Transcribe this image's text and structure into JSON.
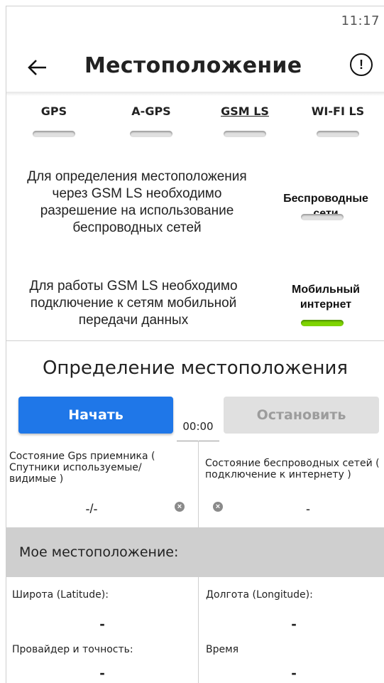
{
  "status_bar": {
    "time": "11:17"
  },
  "app_bar": {
    "title": "Местоположение",
    "back_icon": "arrow-left-icon",
    "info_icon": "exclamation-circle-icon"
  },
  "tabs": [
    {
      "label": "GPS",
      "enabled": false
    },
    {
      "label": "A-GPS",
      "enabled": false
    },
    {
      "label": "GSM LS",
      "enabled": false,
      "underlined": true
    },
    {
      "label": "WI-FI LS",
      "enabled": false
    }
  ],
  "wireless": {
    "description": "Для определения местоположения через GSM LS необходимо разрешение на использование беспроводных сетей",
    "toggle_label": "Беспроводные сети",
    "enabled": false
  },
  "mobile": {
    "description": "Для работы GSM LS необходимо подключение к сетям мобильной передачи данных",
    "toggle_label": "Мобильный интернет",
    "enabled": true,
    "on_color": "#7fd400"
  },
  "detection": {
    "title": "Определение местоположения",
    "start_label": "Начать",
    "stop_label": "Остановить",
    "timer": "00:00",
    "start_color": "#1f77e8"
  },
  "gps_state": {
    "label": "Состояние Gps приемника ( Спутники используемые/ видимые )",
    "value": "-/-"
  },
  "net_state": {
    "label": "Состояние беспроводных сетей ( подключение к интернету )",
    "value": "-"
  },
  "my_location": {
    "header": "Мое местоположение:",
    "latitude_label": "Широта (Latitude):",
    "latitude_value": "-",
    "longitude_label": "Долгота (Longitude):",
    "longitude_value": "-",
    "provider_label": "Провайдер и точность:",
    "provider_value": "-",
    "time_label": "Время",
    "time_value": "-"
  }
}
